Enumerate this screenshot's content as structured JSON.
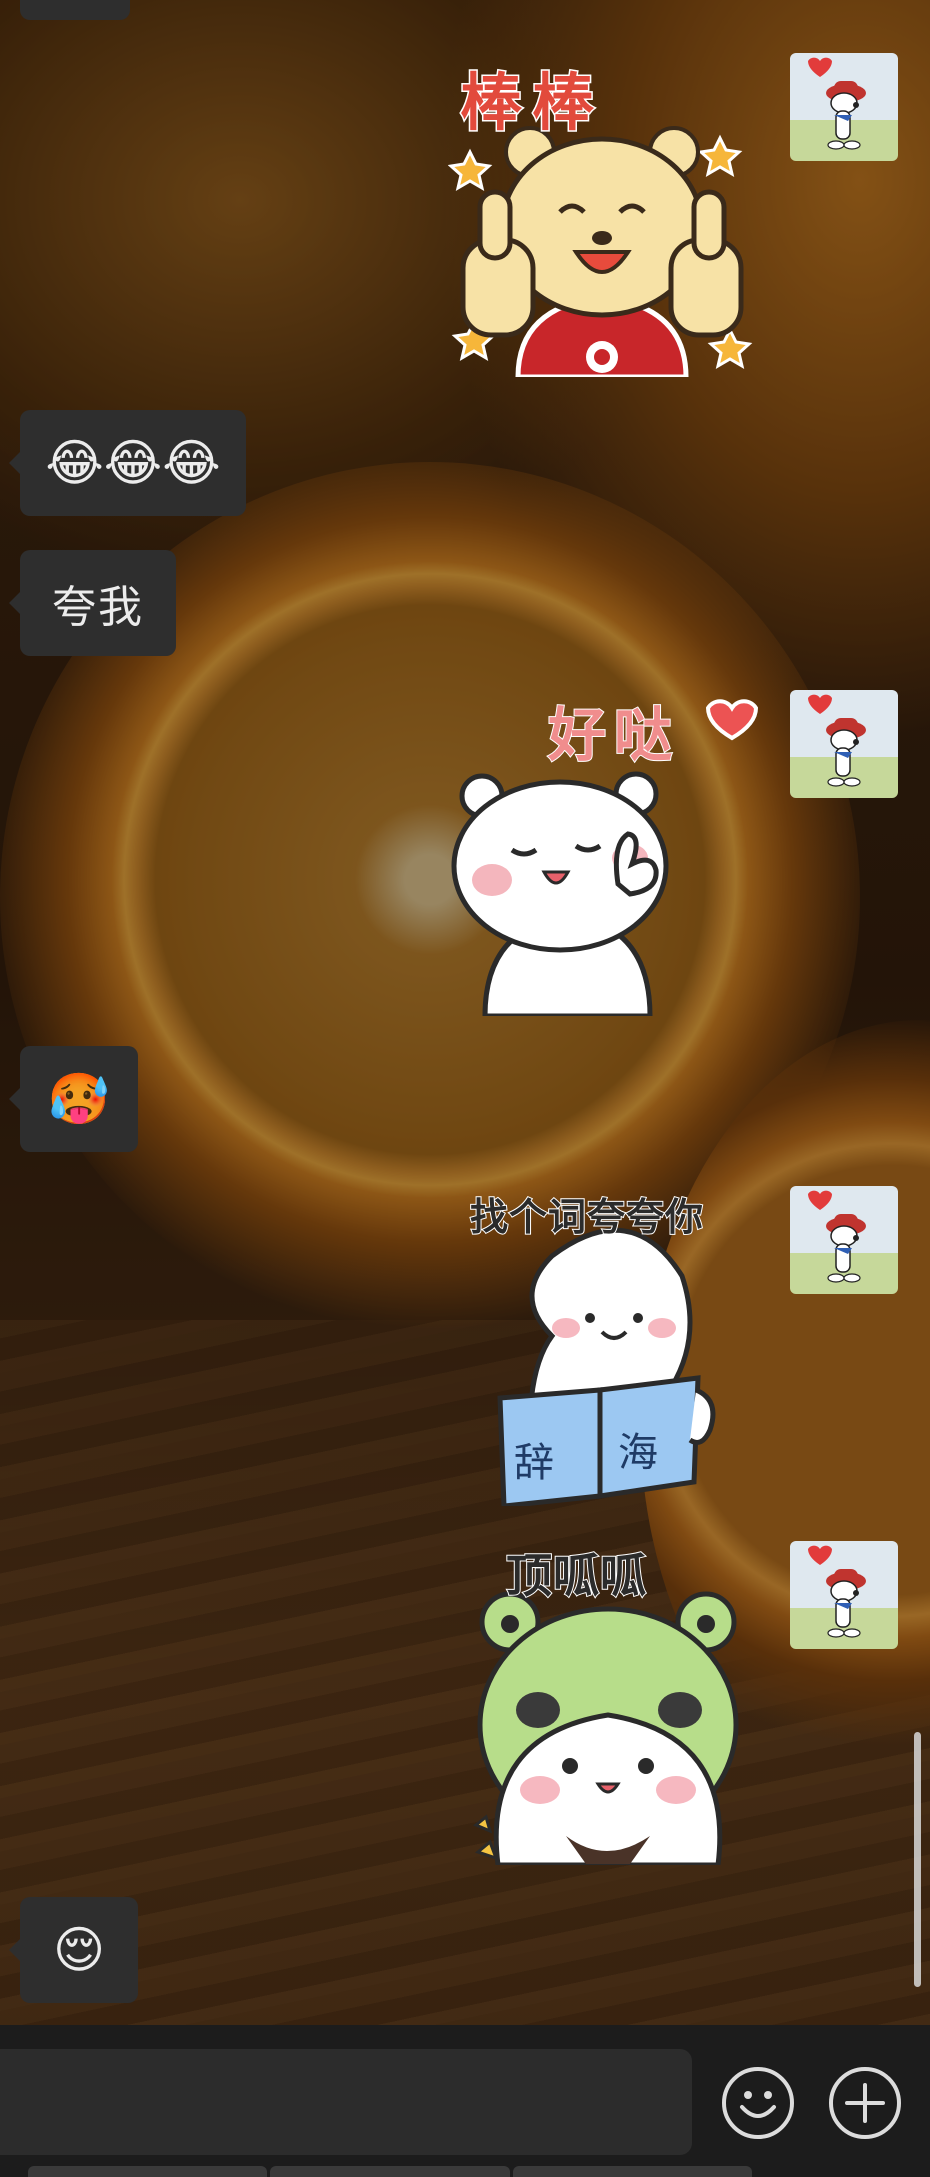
{
  "chat": {
    "messages": [
      {
        "side": "right",
        "kind": "sticker",
        "caption": "棒棒",
        "desc": "bear thumbs up"
      },
      {
        "side": "left",
        "kind": "emoji",
        "text": "😂😂😂"
      },
      {
        "side": "left",
        "kind": "text",
        "text": "夸我"
      },
      {
        "side": "right",
        "kind": "sticker",
        "caption": "好哒",
        "desc": "white bear ok"
      },
      {
        "side": "left",
        "kind": "emoji",
        "text": "🥵"
      },
      {
        "side": "right",
        "kind": "sticker",
        "caption": "找个词夸夸你",
        "book_chars": [
          "辞",
          "海"
        ],
        "desc": "white ghost reading"
      },
      {
        "side": "right",
        "kind": "sticker",
        "caption": "顶呱呱",
        "desc": "panda in frog hat"
      },
      {
        "side": "left",
        "kind": "emoji",
        "text": "😌"
      }
    ]
  },
  "composer": {
    "input_value": "",
    "emoji_icon": "smile-icon",
    "more_icon": "plus-circle-icon"
  },
  "colors": {
    "bubble": "#2e2e2e",
    "bottom_bar": "#1c1c1c",
    "input": "#2c2c2c"
  }
}
